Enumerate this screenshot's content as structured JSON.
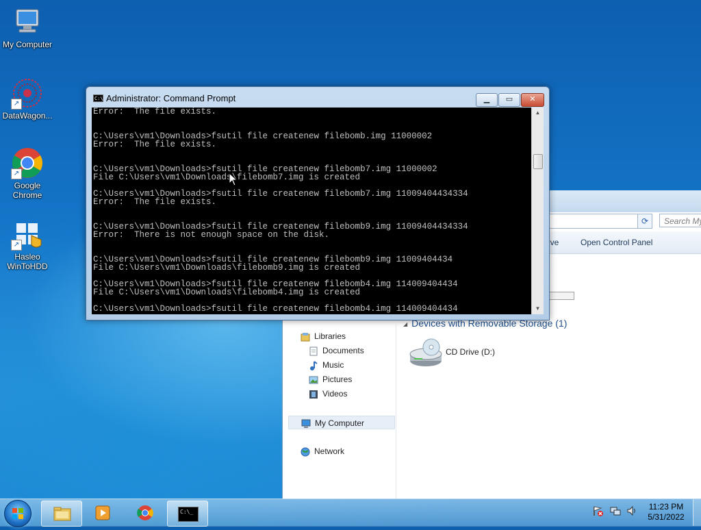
{
  "desktop": {
    "icons": [
      {
        "label": "My Computer"
      },
      {
        "label": "DataWagon..."
      },
      {
        "label": "Google Chrome"
      },
      {
        "label": "Hasleo WinToHDD"
      }
    ]
  },
  "explorer": {
    "search_placeholder": "Search My",
    "toolbar": {
      "drive_partial": "ive",
      "open_control_panel": "Open Control Panel"
    },
    "nav": {
      "libraries": "Libraries",
      "documents": "Documents",
      "music": "Music",
      "pictures": "Pictures",
      "videos": "Videos",
      "my_computer": "My Computer",
      "network": "Network"
    },
    "group_header": "Devices with Removable Storage (1)",
    "cd_drive": "CD Drive (D:)"
  },
  "cmd": {
    "title": "Administrator: Command Prompt",
    "icon_text": "C:\\",
    "lines": [
      "Error:  The file exists.",
      "",
      "",
      "C:\\Users\\vm1\\Downloads>fsutil file createnew filebomb.img 11000002",
      "Error:  The file exists.",
      "",
      "",
      "C:\\Users\\vm1\\Downloads>fsutil file createnew filebomb7.img 11000002",
      "File C:\\Users\\vm1\\Downloads\\filebomb7.img is created",
      "",
      "C:\\Users\\vm1\\Downloads>fsutil file createnew filebomb7.img 11009404434334",
      "Error:  The file exists.",
      "",
      "",
      "C:\\Users\\vm1\\Downloads>fsutil file createnew filebomb9.img 11009404434334",
      "Error:  There is not enough space on the disk.",
      "",
      "",
      "C:\\Users\\vm1\\Downloads>fsutil file createnew filebomb9.img 11009404434",
      "File C:\\Users\\vm1\\Downloads\\filebomb9.img is created",
      "",
      "C:\\Users\\vm1\\Downloads>fsutil file createnew filebomb4.img 114009404434",
      "File C:\\Users\\vm1\\Downloads\\filebomb4.img is created",
      "",
      "C:\\Users\\vm1\\Downloads>fsutil file createnew filebomb4.img 114009404434"
    ]
  },
  "taskbar": {
    "clock_time": "11:23 PM",
    "clock_date": "5/31/2022",
    "cmd_icon_text": "C:\\_"
  }
}
